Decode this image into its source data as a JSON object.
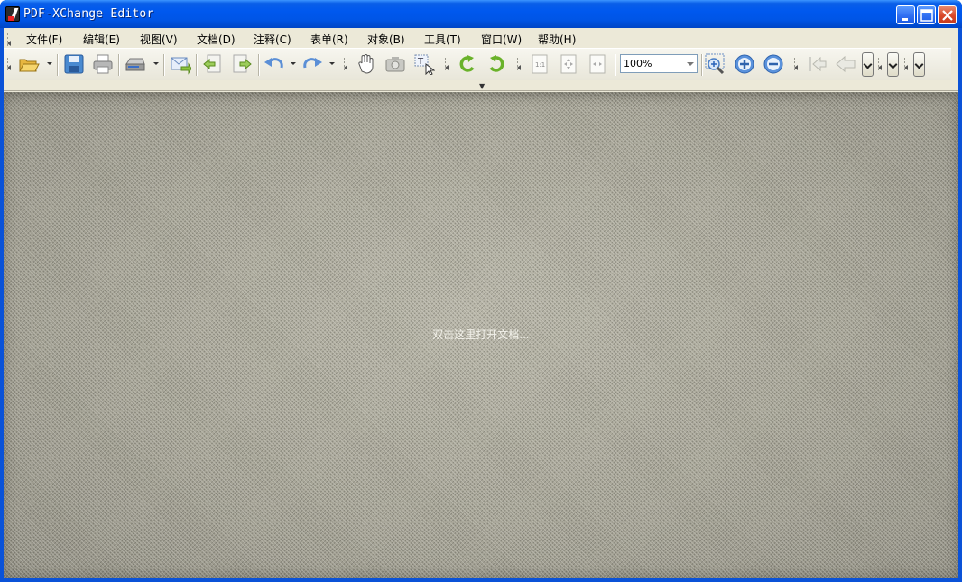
{
  "window": {
    "title": "PDF-XChange Editor",
    "buttons": {
      "minimize": "minimize",
      "maximize": "maximize",
      "close": "close"
    }
  },
  "menu": [
    {
      "label": "文件(F)"
    },
    {
      "label": "编辑(E)"
    },
    {
      "label": "视图(V)"
    },
    {
      "label": "文档(D)"
    },
    {
      "label": "注释(C)"
    },
    {
      "label": "表单(R)"
    },
    {
      "label": "对象(B)"
    },
    {
      "label": "工具(T)"
    },
    {
      "label": "窗口(W)"
    },
    {
      "label": "帮助(H)"
    }
  ],
  "toolbar": {
    "zoom_value": "100%",
    "icons": [
      "open-icon",
      "save-icon",
      "print-icon",
      "scan-icon",
      "email-icon",
      "export-icon",
      "import-icon",
      "undo-icon",
      "redo-icon",
      "hand-icon",
      "snapshot-icon",
      "select-text-icon",
      "rotate-left-icon",
      "rotate-right-icon",
      "actual-size-icon",
      "fit-page-icon",
      "fit-width-icon",
      "zoom-in-box-icon",
      "zoom-in-icon",
      "zoom-out-icon",
      "first-page-icon",
      "previous-view-icon"
    ]
  },
  "workspace": {
    "hint": "双击这里打开文档..."
  },
  "colors": {
    "titlebar": "#0058ee",
    "chrome": "#ece9d8",
    "workspace": "#aeac9e"
  }
}
